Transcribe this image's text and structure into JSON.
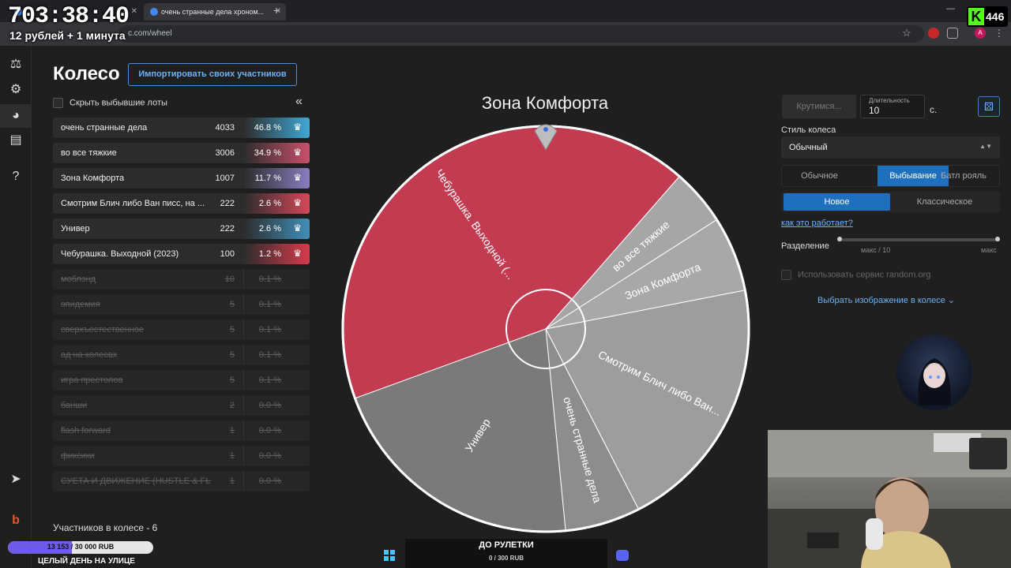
{
  "browser": {
    "tabs": [
      {
        "title": ""
      },
      {
        "title": "очень странные дела хроном..."
      }
    ],
    "url": "c.com/wheel"
  },
  "overlay": {
    "timer": "703:38:40",
    "rate": "12 рублей + 1 минута",
    "kick_count": "446",
    "donation_progress": "13 153 / 30 000 RUB",
    "donation_fraction": 0.438,
    "donation_goal_label": "ЦЕЛЫЙ ДЕНЬ НА УЛИЦЕ",
    "roulette_title": "ДО РУЛЕТКИ",
    "roulette_progress": "0 / 300 RUB"
  },
  "page": {
    "title": "Колесо",
    "import_button": "Импортировать своих участников",
    "hide_dropped": "Скрыть выбывшие лоты",
    "participants_count": "Участников в колесе - 6"
  },
  "lots": [
    {
      "name": "очень странные дела",
      "amount": "4033",
      "percent": "46.8 %",
      "color": "#3fa9d6",
      "active": true
    },
    {
      "name": "во все тяжкие",
      "amount": "3006",
      "percent": "34.9 %",
      "color": "#c9506a",
      "active": true
    },
    {
      "name": "Зона Комфорта",
      "amount": "1007",
      "percent": "11.7 %",
      "color": "#8a7cc0",
      "active": true
    },
    {
      "name": "Смотрим Блич либо Ван писс, на ...",
      "amount": "222",
      "percent": "2.6 %",
      "color": "#d6475a",
      "active": true
    },
    {
      "name": "Универ",
      "amount": "222",
      "percent": "2.6 %",
      "color": "#3f8fb8",
      "active": true
    },
    {
      "name": "Чебурашка. Выходной (2023)",
      "amount": "100",
      "percent": "1.2 %",
      "color": "#d63b4b",
      "active": true
    },
    {
      "name": "моблэнд",
      "amount": "10",
      "percent": "0.1 %",
      "active": false
    },
    {
      "name": "эпидемия",
      "amount": "5",
      "percent": "0.1 %",
      "active": false
    },
    {
      "name": "сверхъестественное",
      "amount": "5",
      "percent": "0.1 %",
      "active": false
    },
    {
      "name": "ад на колесах",
      "amount": "5",
      "percent": "0.1 %",
      "active": false
    },
    {
      "name": "игра престолов",
      "amount": "5",
      "percent": "0.1 %",
      "active": false
    },
    {
      "name": "банши",
      "amount": "2",
      "percent": "0.0 %",
      "active": false
    },
    {
      "name": "flash forward",
      "amount": "1",
      "percent": "0.0 %",
      "active": false
    },
    {
      "name": "фиксики",
      "amount": "1",
      "percent": "0.0 %",
      "active": false
    },
    {
      "name": "СУЕТА И ДВИЖЕНИЕ (HUSTLE & FLO...",
      "amount": "1",
      "percent": "0.0 %",
      "active": false
    }
  ],
  "wheel": {
    "current": "Зона Комфорта",
    "segments": [
      {
        "label": "Чебурашка. Выходной (...",
        "color": "#c33b50",
        "share": 0.42
      },
      {
        "label": "во все тяжкие",
        "color": "#a6a6a6",
        "share": 0.045
      },
      {
        "label": "Зона Комфорта",
        "color": "#a8a8a8",
        "share": 0.06
      },
      {
        "label": "Смотрим Блич либо Ван...",
        "color": "#9d9d9d",
        "share": 0.205
      },
      {
        "label": "очень странные дела",
        "color": "#8d8d8d",
        "share": 0.06
      },
      {
        "label": "Универ",
        "color": "#7a7a7a",
        "share": 0.21
      }
    ]
  },
  "controls": {
    "spin_button": "Крутимся...",
    "duration_label": "Длительность",
    "duration_value": "10",
    "duration_unit": "с.",
    "wheel_style_label": "Стиль колеса",
    "wheel_style_value": "Обычный",
    "modes": [
      "Обычное",
      "Выбывание",
      "Батл рояль"
    ],
    "active_mode": "Выбывание",
    "submodes": [
      "Новое",
      "Классическое"
    ],
    "active_submode": "Новое",
    "how_it_works": "как это работает?",
    "split_label": "Разделение",
    "split_min": "макс / 10",
    "split_max": "макс",
    "random_org": "Использовать сервис random.org",
    "choose_image": "Выбрать изображение в колесе"
  }
}
